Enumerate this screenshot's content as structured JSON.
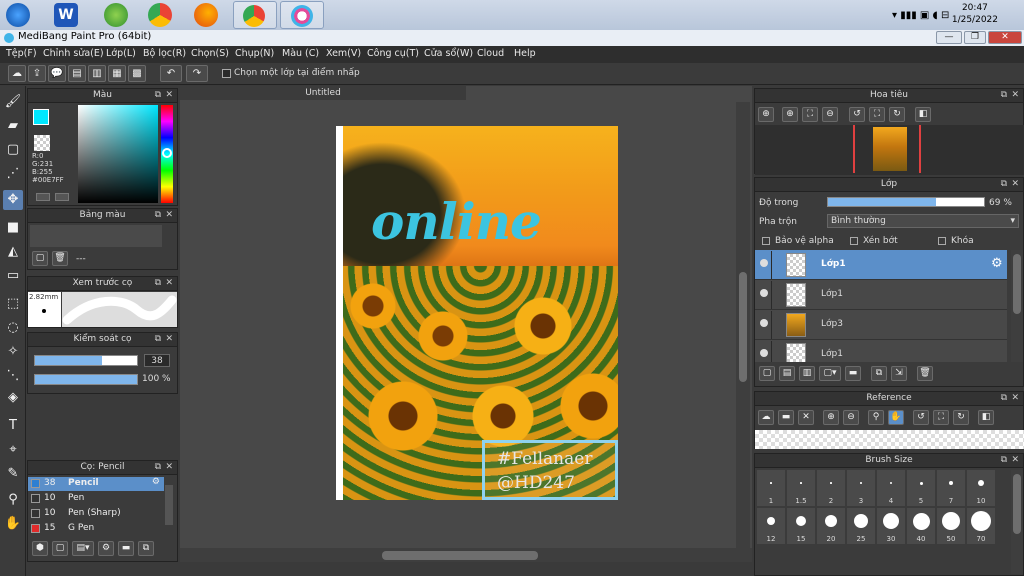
{
  "taskbar": {
    "time": "20:47",
    "date": "1/25/2022"
  },
  "window": {
    "title": "MediBang Paint Pro (64bit)",
    "min": "—",
    "max": "❐",
    "close": "✕"
  },
  "menu": [
    "Tệp(F)",
    "Chỉnh sửa(E)",
    "Lớp(L)",
    "Bộ lọc(R)",
    "Chọn(S)",
    "Chụp(N)",
    "Màu (C)",
    "Xem(V)",
    "Công cụ(T)",
    "Cửa sổ(W)",
    "Cloud",
    "Help"
  ],
  "toolbar": {
    "checkbox_label": "Chọn một lớp tại điểm nhấp"
  },
  "color_panel": {
    "title": "Màu",
    "r": "R:0",
    "g": "G:231",
    "b": "B:255",
    "hex": "#00E7FF"
  },
  "palette_panel": {
    "title": "Bảng màu",
    "dash": "---"
  },
  "brush_preview": {
    "title": "Xem trước cọ",
    "size": "2.82mm"
  },
  "brush_control": {
    "title": "Kiểm soát cọ",
    "size_value": "38",
    "size_fraction": 0.66,
    "opacity_value": "100 %",
    "opacity_fraction": 1.0
  },
  "brush_list": {
    "title": "Cọ: Pencil",
    "items": [
      {
        "size": "38",
        "name": "Pencil",
        "color": "#2d7fd1",
        "selected": true
      },
      {
        "size": "10",
        "name": "Pen",
        "color": "#333333",
        "selected": false
      },
      {
        "size": "10",
        "name": "Pen (Sharp)",
        "color": "#333333",
        "selected": false
      },
      {
        "size": "15",
        "name": "G Pen",
        "color": "#e02a2a",
        "selected": false
      }
    ]
  },
  "document": {
    "tab": "Untitled",
    "overlay_text": "online",
    "watermark_line1": "#Fellanaer",
    "watermark_line2": "@HD247"
  },
  "navigator": {
    "title": "Hoa tiêu"
  },
  "layer_panel": {
    "title": "Lớp",
    "opacity_label": "Độ trong",
    "opacity_value": "69 %",
    "opacity_fraction": 0.69,
    "blend_label": "Pha trộn",
    "blend_value": "Bình thường",
    "protect_alpha": "Bảo vệ alpha",
    "clipping": "Xén bớt",
    "lock": "Khóa",
    "layers": [
      {
        "name": "Lớp1",
        "selected": true
      },
      {
        "name": "Lớp1",
        "selected": false
      },
      {
        "name": "Lớp3",
        "selected": false
      },
      {
        "name": "Lớp1",
        "selected": false
      }
    ]
  },
  "reference_panel": {
    "title": "Reference"
  },
  "brush_size_panel": {
    "title": "Brush Size",
    "row1": [
      "1",
      "1.5",
      "2",
      "3",
      "4",
      "5",
      "7",
      "10"
    ],
    "row2": [
      "12",
      "15",
      "20",
      "25",
      "30",
      "40",
      "50",
      "70"
    ]
  }
}
